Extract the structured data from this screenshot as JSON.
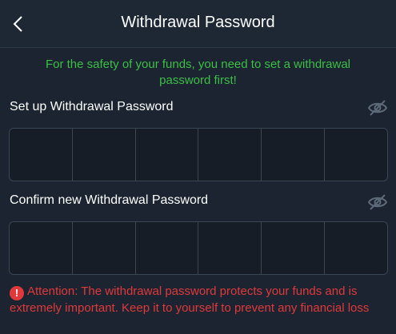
{
  "header": {
    "title": "Withdrawal Password",
    "back_icon": "chevron-left-icon"
  },
  "notice": "For the safety of your funds, you need to set a withdrawal password first!",
  "form": {
    "setup_label": "Set up Withdrawal Password",
    "confirm_label": "Confirm new Withdrawal Password",
    "visibility_icon": "eye-off-icon",
    "pin_length": 6
  },
  "attention": {
    "icon": "exclamation-circle-icon",
    "text": "Attention: The withdrawal password protects your funds and is extremely important. Keep it to yourself to prevent any financial loss"
  },
  "colors": {
    "background": "#1b2430",
    "notice": "#3bbf46",
    "warning": "#e0393b",
    "border": "#3a4654"
  }
}
